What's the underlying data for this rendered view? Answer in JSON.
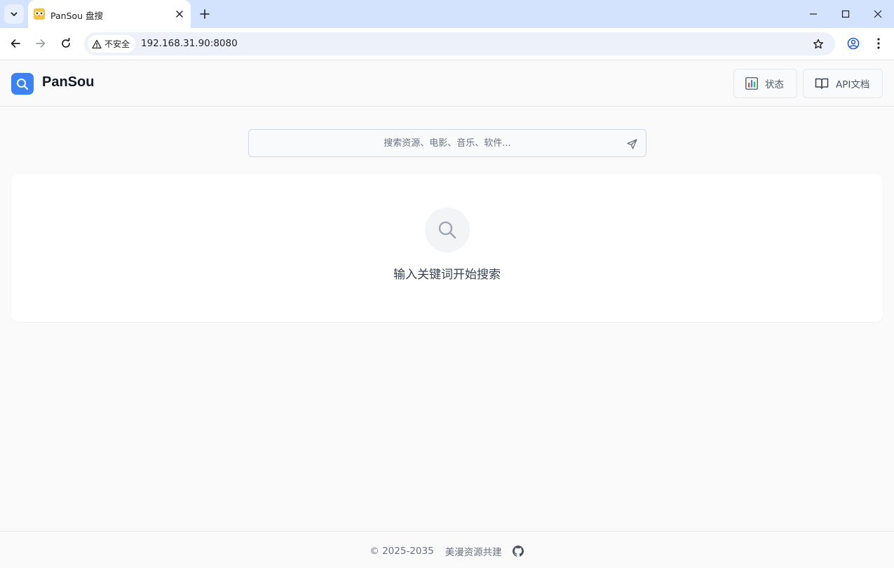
{
  "browser": {
    "tab": {
      "title": "PanSou 盘搜",
      "favicon": "owl-favicon-icon"
    },
    "omnibox": {
      "security_label": "不安全",
      "url": "192.168.31.90:8080"
    }
  },
  "header": {
    "brand": "PanSou",
    "status_button": {
      "label": "状态",
      "icon": "bar-chart-icon"
    },
    "api_button": {
      "label": "API文档",
      "icon": "book-icon"
    }
  },
  "search": {
    "placeholder": "搜索资源、电影、音乐、软件..."
  },
  "empty_state": {
    "message": "输入关键词开始搜索"
  },
  "footer": {
    "copyright": "© 2025-2035",
    "link": "美漫资源共建",
    "icon": "github-icon"
  },
  "colors": {
    "accent": "#3b82f6",
    "tabstrip": "#d3e3fd"
  }
}
